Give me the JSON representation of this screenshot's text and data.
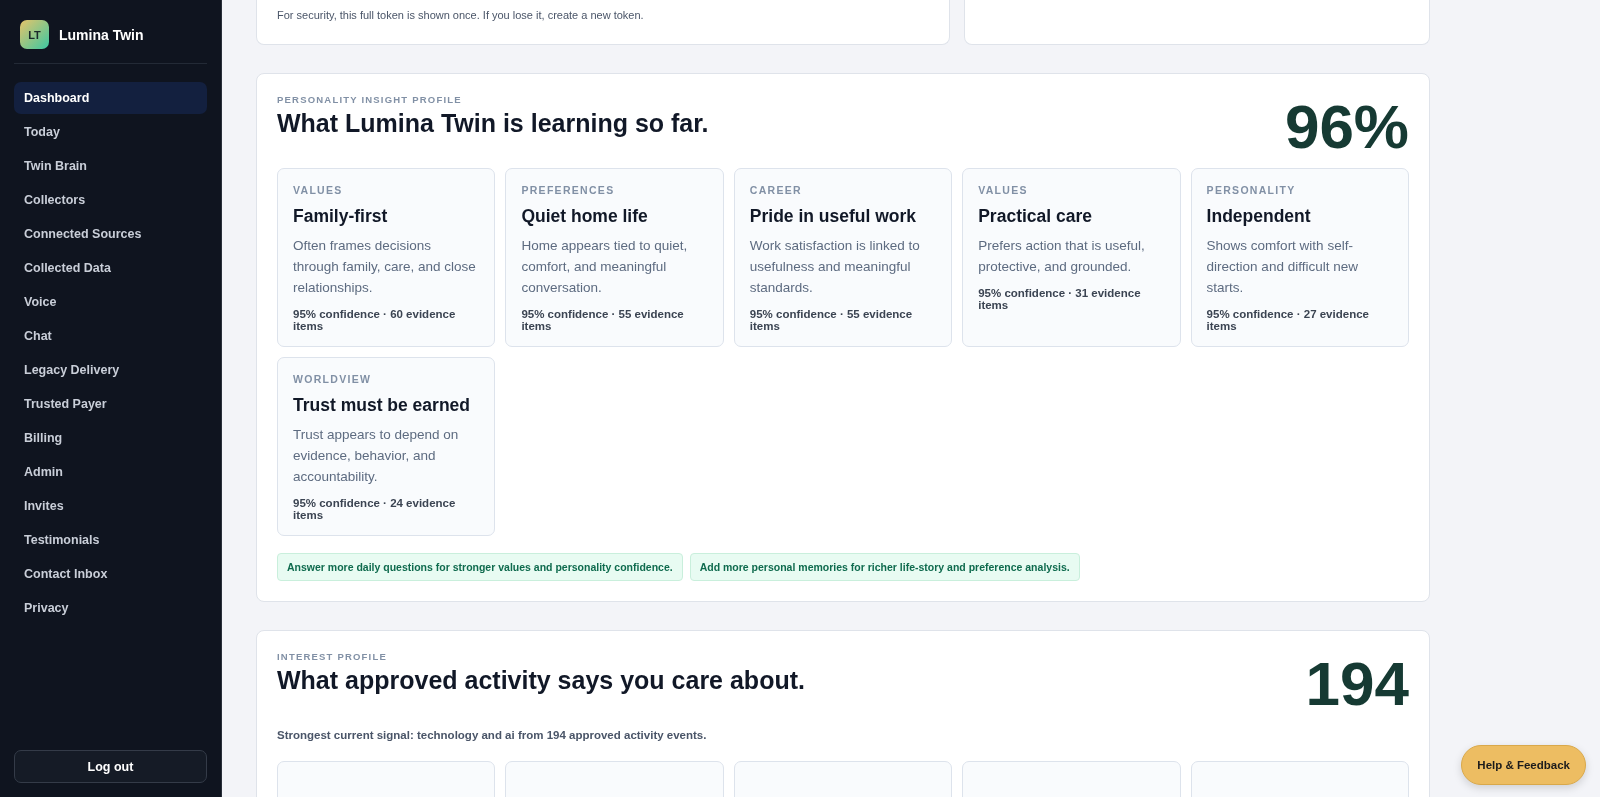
{
  "brand": {
    "initials": "LT",
    "name": "Lumina Twin"
  },
  "nav": [
    {
      "label": "Dashboard",
      "selected": true
    },
    {
      "label": "Today",
      "selected": false
    },
    {
      "label": "Twin Brain",
      "selected": false
    },
    {
      "label": "Collectors",
      "selected": false
    },
    {
      "label": "Connected Sources",
      "selected": false
    },
    {
      "label": "Collected Data",
      "selected": false
    },
    {
      "label": "Voice",
      "selected": false
    },
    {
      "label": "Chat",
      "selected": false
    },
    {
      "label": "Legacy Delivery",
      "selected": false
    },
    {
      "label": "Trusted Payer",
      "selected": false
    },
    {
      "label": "Billing",
      "selected": false
    },
    {
      "label": "Admin",
      "selected": false
    },
    {
      "label": "Invites",
      "selected": false
    },
    {
      "label": "Testimonials",
      "selected": false
    },
    {
      "label": "Contact Inbox",
      "selected": false
    },
    {
      "label": "Privacy",
      "selected": false
    }
  ],
  "logout": "Log out",
  "token_notice": "For security, this full token is shown once. If you lose it, create a new token.",
  "personality": {
    "eyebrow": "PERSONALITY INSIGHT PROFILE",
    "title": "What Lumina Twin is learning so far.",
    "metric": "96%",
    "insights": [
      {
        "category": "VALUES",
        "title": "Family-first",
        "text": "Often frames decisions through family, care, and close relationships.",
        "meta": "95% confidence · 60 evidence items"
      },
      {
        "category": "PREFERENCES",
        "title": "Quiet home life",
        "text": "Home appears tied to quiet, comfort, and meaningful conversation.",
        "meta": "95% confidence · 55 evidence items"
      },
      {
        "category": "CAREER",
        "title": "Pride in useful work",
        "text": "Work satisfaction is linked to usefulness and meaningful standards.",
        "meta": "95% confidence · 55 evidence items"
      },
      {
        "category": "VALUES",
        "title": "Practical care",
        "text": "Prefers action that is useful, protective, and grounded.",
        "meta": "95% confidence · 31 evidence items"
      },
      {
        "category": "PERSONALITY",
        "title": "Independent",
        "text": "Shows comfort with self-direction and difficult new starts.",
        "meta": "95% confidence · 27 evidence items"
      },
      {
        "category": "WORLDVIEW",
        "title": "Trust must be earned",
        "text": "Trust appears to depend on evidence, behavior, and accountability.",
        "meta": "95% confidence · 24 evidence items"
      }
    ],
    "suggestions": [
      "Answer more daily questions for stronger values and personality confidence.",
      "Add more personal memories for richer life-story and preference analysis."
    ]
  },
  "interest": {
    "eyebrow": "INTEREST PROFILE",
    "title": "What approved activity says you care about.",
    "metric": "194",
    "summary": "Strongest current signal: technology and ai from 194 approved activity events."
  },
  "help_button": "Help & Feedback"
}
